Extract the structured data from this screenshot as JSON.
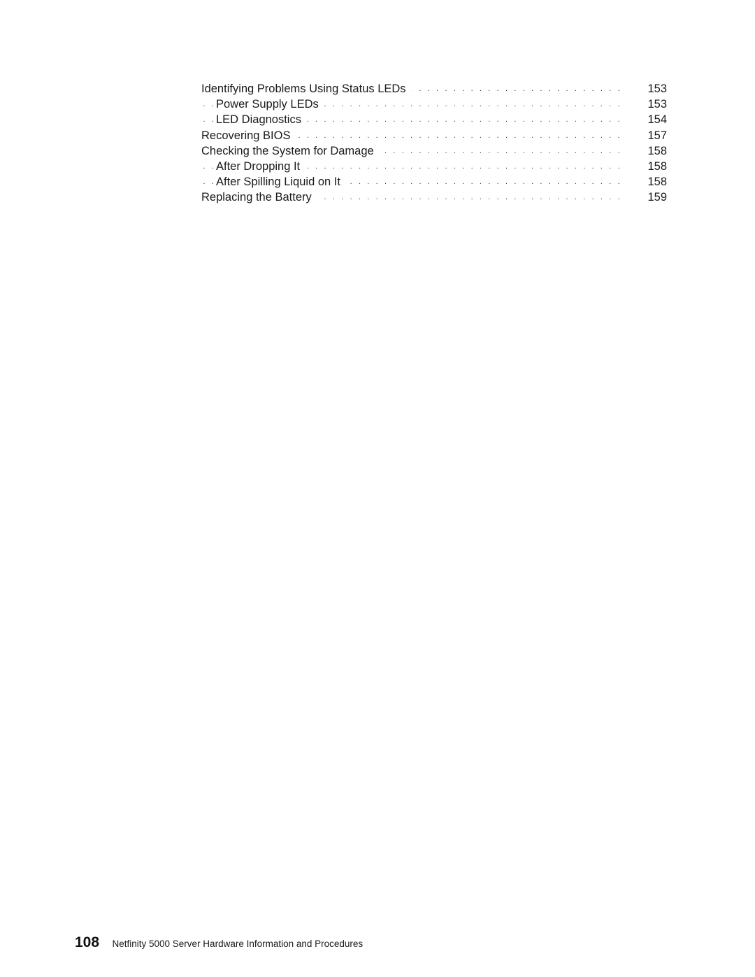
{
  "toc": {
    "entries": [
      {
        "title": "Identifying Problems Using Status LEDs",
        "page": "153",
        "level": 1
      },
      {
        "title": "Power Supply LEDs",
        "page": "153",
        "level": 2
      },
      {
        "title": "LED Diagnostics",
        "page": "154",
        "level": 2
      },
      {
        "title": "Recovering BIOS",
        "page": "157",
        "level": 1
      },
      {
        "title": "Checking the System for Damage",
        "page": "158",
        "level": 1
      },
      {
        "title": "After Dropping It",
        "page": "158",
        "level": 2
      },
      {
        "title": "After Spilling Liquid on It",
        "page": "158",
        "level": 2
      },
      {
        "title": "Replacing the Battery",
        "page": "159",
        "level": 1
      }
    ],
    "leader_char": "."
  },
  "footer": {
    "page_number": "108",
    "book_title": "Netfinity 5000 Server Hardware Information and Procedures"
  }
}
